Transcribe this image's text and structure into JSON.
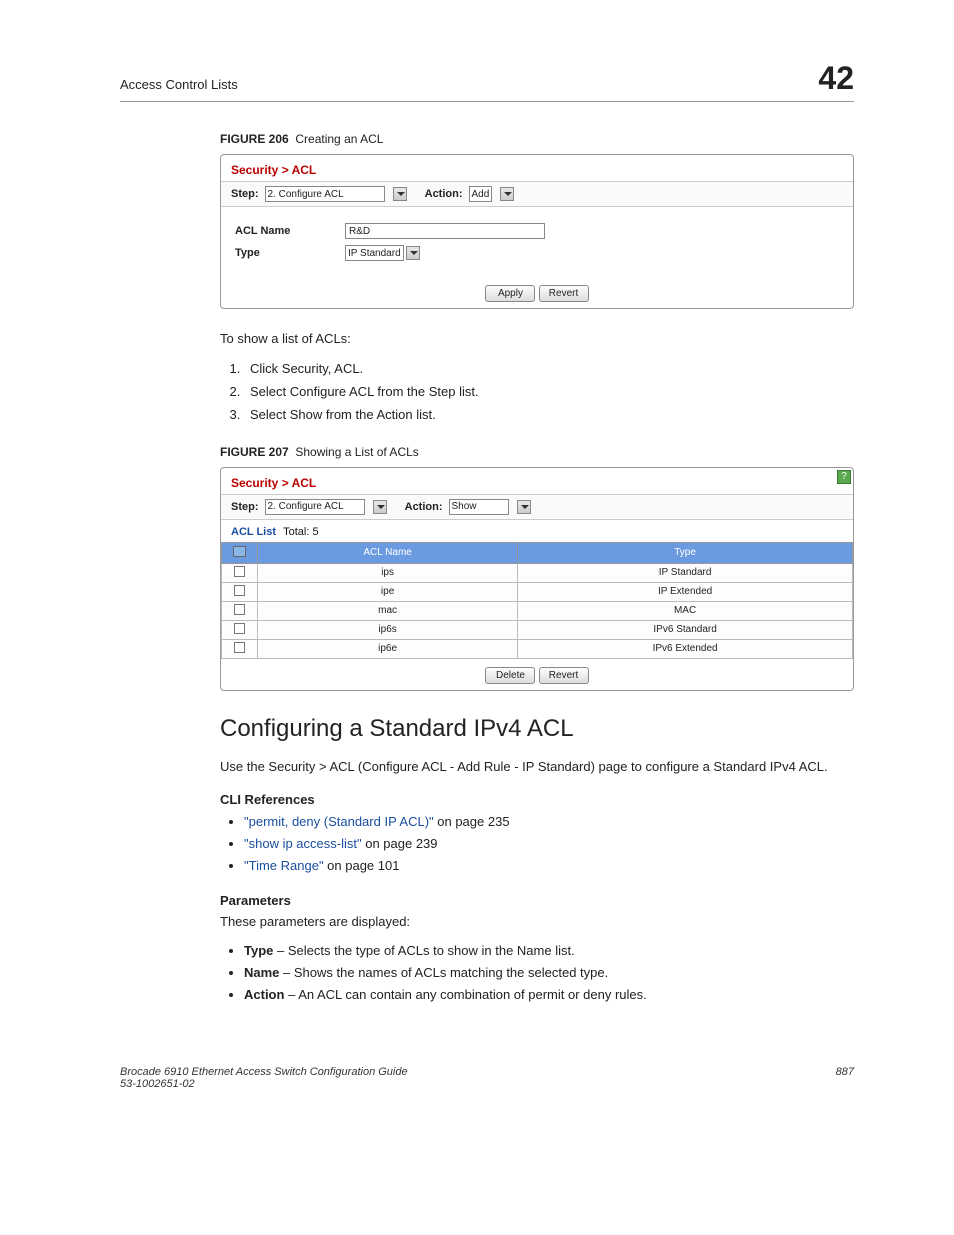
{
  "header": {
    "section": "Access Control Lists",
    "chapter": "42"
  },
  "figure206": {
    "label": "FIGURE 206",
    "title": "Creating an ACL",
    "breadcrumb": "Security > ACL",
    "step_label": "Step:",
    "step_value": "2. Configure ACL",
    "action_label": "Action:",
    "action_value": "Add",
    "acl_name_label": "ACL Name",
    "acl_name_value": "R&D",
    "type_label": "Type",
    "type_value": "IP Standard",
    "apply": "Apply",
    "revert": "Revert"
  },
  "para1": "To show a list of ACLs:",
  "steps1": [
    "Click Security, ACL.",
    "Select Configure ACL from the Step list.",
    "Select Show from the Action list."
  ],
  "figure207": {
    "label": "FIGURE 207",
    "title": "Showing a List of ACLs",
    "breadcrumb": "Security > ACL",
    "step_label": "Step:",
    "step_value": "2. Configure ACL",
    "action_label": "Action:",
    "action_value": "Show",
    "list_header": "ACL List",
    "total_label": "Total:",
    "total_value": "5",
    "col_name": "ACL Name",
    "col_type": "Type",
    "rows": [
      {
        "name": "ips",
        "type": "IP Standard"
      },
      {
        "name": "ipe",
        "type": "IP Extended"
      },
      {
        "name": "mac",
        "type": "MAC"
      },
      {
        "name": "ip6s",
        "type": "IPv6 Standard"
      },
      {
        "name": "ip6e",
        "type": "IPv6 Extended"
      }
    ],
    "delete": "Delete",
    "revert": "Revert",
    "help": "?"
  },
  "section_heading": "Configuring a Standard IPv4 ACL",
  "section_intro": "Use the Security > ACL (Configure ACL - Add Rule - IP Standard) page to configure a Standard IPv4 ACL.",
  "cli_ref_head": "CLI References",
  "cli_refs": [
    {
      "link": "\"permit, deny (Standard IP ACL)\"",
      "suffix": " on page 235"
    },
    {
      "link": "\"show ip access-list\"",
      "suffix": " on page 239"
    },
    {
      "link": "\"Time Range\"",
      "suffix": " on page 101"
    }
  ],
  "params_head": "Parameters",
  "params_intro": "These parameters are displayed:",
  "params": [
    {
      "name": "Type",
      "desc": " – Selects the type of ACLs to show in the Name list."
    },
    {
      "name": "Name",
      "desc": " – Shows the names of ACLs matching the selected type."
    },
    {
      "name": "Action",
      "desc": " – An ACL can contain any combination of permit or deny rules."
    }
  ],
  "footer": {
    "left1": "Brocade 6910 Ethernet Access Switch Configuration Guide",
    "left2": "53-1002651-02",
    "right": "887"
  }
}
